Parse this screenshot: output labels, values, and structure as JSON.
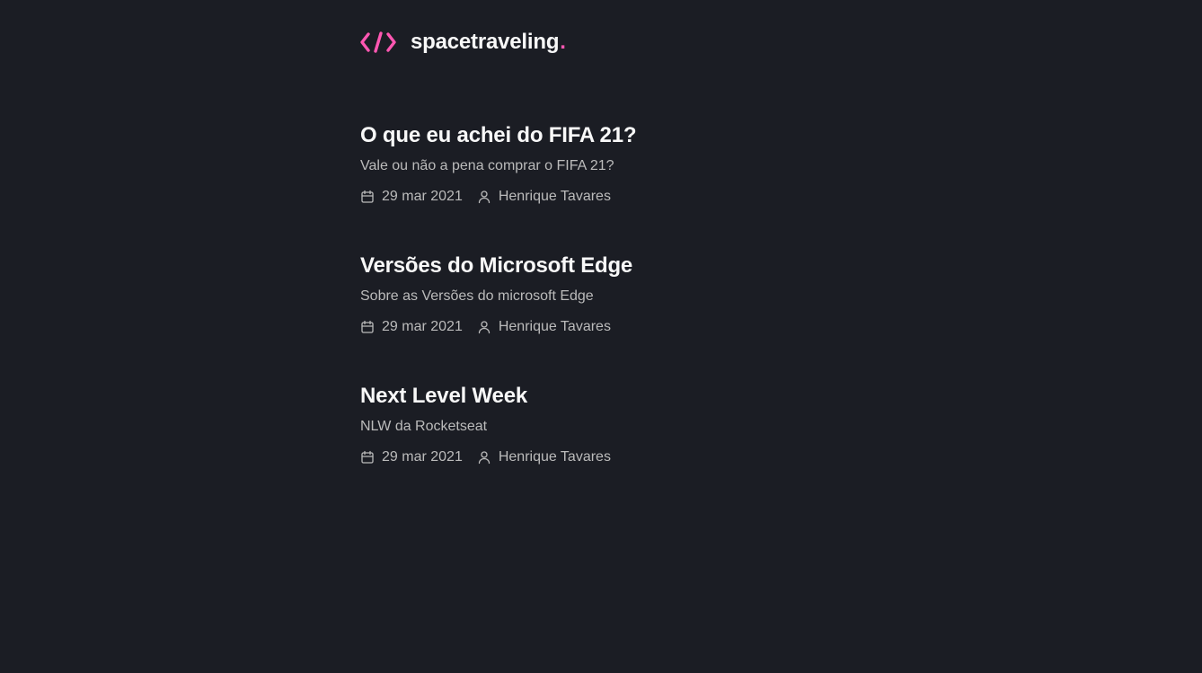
{
  "header": {
    "logo_text": "spacetraveling",
    "logo_dot": ".",
    "logo_icon": "code-brackets-icon",
    "accent_color": "#ff57b2"
  },
  "posts": [
    {
      "title": "O que eu achei do FIFA 21?",
      "subtitle": "Vale ou não a pena comprar o FIFA 21?",
      "date": "29 mar 2021",
      "author": "Henrique Tavares"
    },
    {
      "title": "Versões do Microsoft Edge",
      "subtitle": "Sobre as Versões do microsoft Edge",
      "date": "29 mar 2021",
      "author": "Henrique Tavares"
    },
    {
      "title": "Next Level Week",
      "subtitle": "NLW da Rocketseat",
      "date": "29 mar 2021",
      "author": "Henrique Tavares"
    }
  ],
  "icons": {
    "date": "calendar-icon",
    "author": "user-icon"
  },
  "colors": {
    "background": "#1b1d24",
    "heading": "#f8f8f8",
    "body_text": "#bbbbbb"
  }
}
